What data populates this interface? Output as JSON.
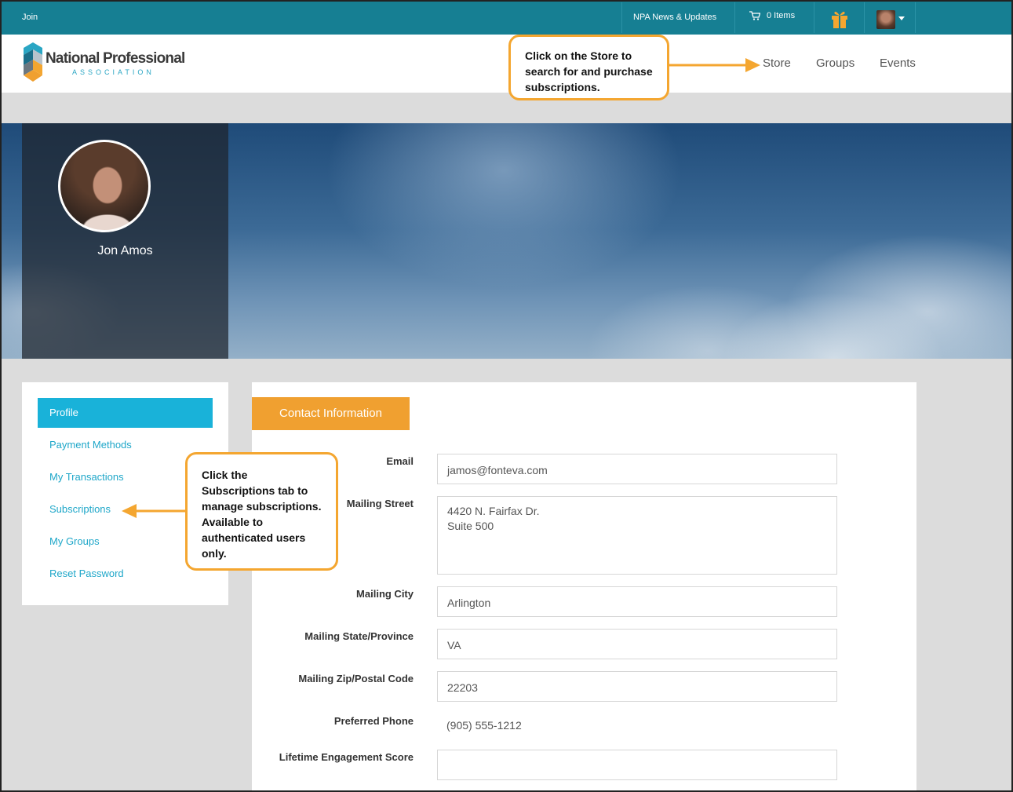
{
  "topbar": {
    "join": "Join",
    "news": "NPA News & Updates",
    "cart_label": "0 Items",
    "icons": [
      "cart-icon",
      "gift-icon",
      "user-avatar",
      "caret-down-icon"
    ],
    "bg_color": "#167f93"
  },
  "header": {
    "logo_title": "National Professional",
    "logo_subtitle": "ASSOCIATION",
    "nav": [
      "Store",
      "Groups",
      "Events"
    ]
  },
  "profile": {
    "name": "Jon Amos"
  },
  "sidebar": {
    "items": [
      {
        "label": "Profile",
        "active": true
      },
      {
        "label": "Payment Methods",
        "active": false
      },
      {
        "label": "My Transactions",
        "active": false
      },
      {
        "label": "Subscriptions",
        "active": false
      },
      {
        "label": "My Groups",
        "active": false
      },
      {
        "label": "Reset Password",
        "active": false
      }
    ],
    "active_color": "#19b2d9",
    "link_color": "#1fa7c9"
  },
  "main": {
    "tab": "Contact Information",
    "tab_color": "#f0a030",
    "fields": {
      "email_label": "Email",
      "email_value": "jamos@fonteva.com",
      "street_label": "Mailing Street",
      "street_line1": "4420 N. Fairfax Dr.",
      "street_line2": "Suite 500",
      "city_label": "Mailing City",
      "city_value": "Arlington",
      "state_label": "Mailing State/Province",
      "state_value": "VA",
      "zip_label": "Mailing Zip/Postal Code",
      "zip_value": "22203",
      "phone_label": "Preferred Phone",
      "phone_value": "(905) 555-1212",
      "score_label": "Lifetime Engagement Score",
      "score_value": ""
    }
  },
  "callouts": {
    "store_lines": [
      "Click on the Store to",
      "search for and purchase",
      "subscriptions."
    ],
    "subs_lines": [
      "Click the",
      "Subscriptions tab to",
      "manage subscriptions.",
      "Available to",
      "authenticated users",
      "only."
    ],
    "color": "#f4a630"
  }
}
